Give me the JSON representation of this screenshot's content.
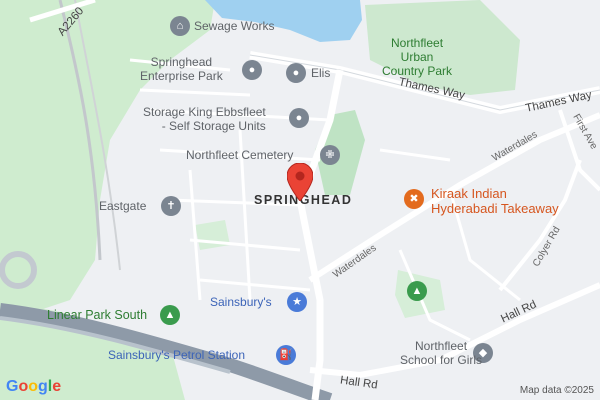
{
  "map": {
    "area_label": "SPRINGHEAD",
    "attribution": "Map data ©2025",
    "logo": "Google",
    "logo_colors": [
      "#4285F4",
      "#EA4335",
      "#FBBC05",
      "#4285F4",
      "#34A853",
      "#EA4335"
    ]
  },
  "places": {
    "sewage_works": "Sewage Works",
    "enterprise_park": "Springhead\nEnterprise Park",
    "elis": "Elis",
    "storage_king": "Storage King Ebbsfleet\n- Self Storage Units",
    "cemetery": "Northfleet Cemetery",
    "eastgate": "Eastgate",
    "kiraak": "Kiraak Indian\nHyderabadi Takeaway",
    "sainsburys": "Sainsbury's",
    "linear_park": "Linear Park South",
    "petrol": "Sainsbury's Petrol Station",
    "school": "Northfleet\nSchool for Girls",
    "country_park": "Northfleet\nUrban\nCountry Park"
  },
  "roads": {
    "a2260": "A2260",
    "thames_way_1": "Thames Way",
    "thames_way_2": "Thames Way",
    "waterdales_1": "Waterdales",
    "waterdales_2": "Waterdales",
    "first_ave": "First Ave",
    "colyer_rd": "Colyer Rd",
    "hall_rd_1": "Hall Rd",
    "hall_rd_2": "Hall Rd"
  },
  "icons": {
    "sewage_works": "building-icon",
    "enterprise_park": "place-icon",
    "elis": "place-icon",
    "storage_king": "place-icon",
    "cemetery": "cemetery-icon",
    "eastgate": "church-icon",
    "kiraak": "restaurant-icon",
    "sainsburys": "shopping-icon",
    "linear_park": "park-icon",
    "petrol": "fuel-icon",
    "school": "school-icon",
    "country_park_tree": "park-icon",
    "location_marker": "location-pin-icon"
  },
  "colors": {
    "water": "#9fd0f0",
    "park": "#c8e9c9",
    "marker": "#ea4335"
  }
}
